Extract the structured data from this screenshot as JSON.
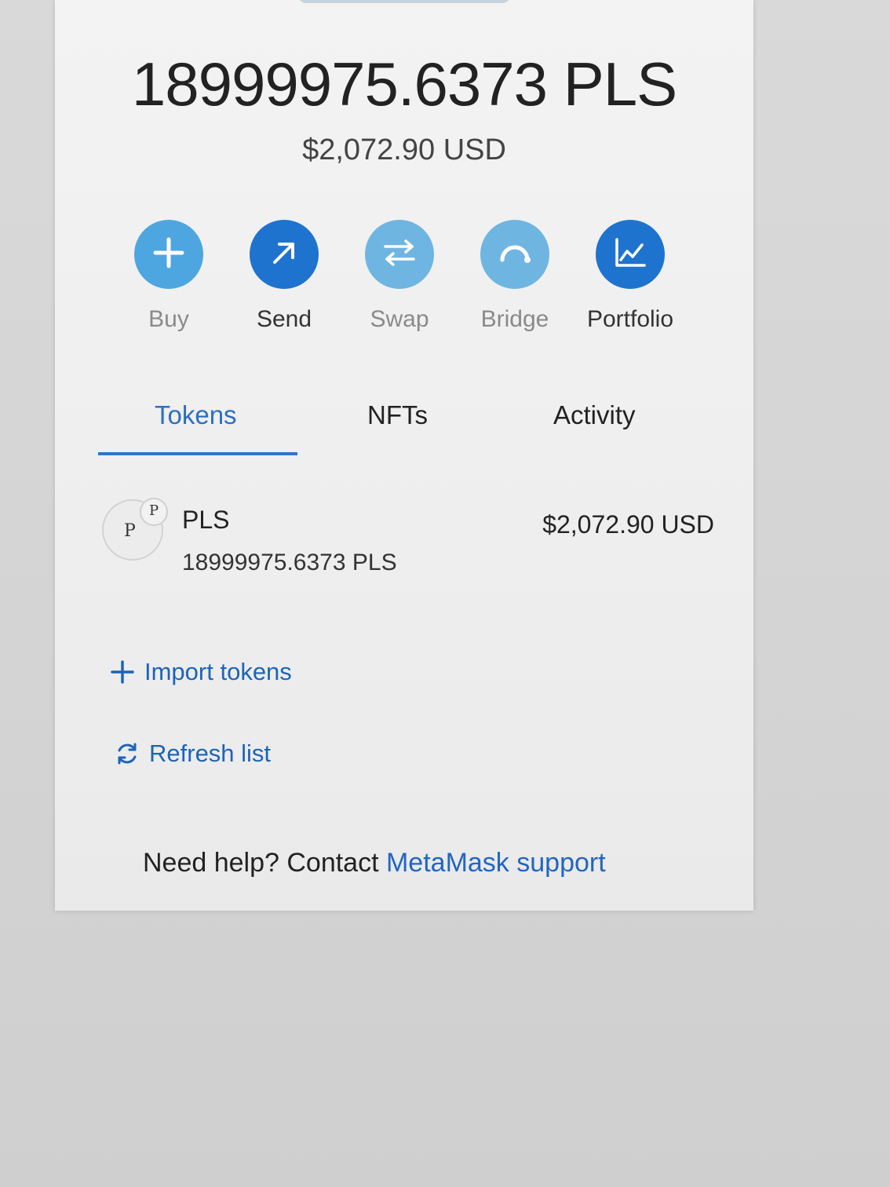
{
  "balance": {
    "amount": "18999975.6373 PLS",
    "fiat": "$2,072.90 USD"
  },
  "actions": [
    {
      "label": "Buy",
      "icon": "plus-icon",
      "color": "#4ea6e0"
    },
    {
      "label": "Send",
      "icon": "arrow-up-right-icon",
      "color": "#1e73cf"
    },
    {
      "label": "Swap",
      "icon": "swap-arrows-icon",
      "color": "#6fb5e2"
    },
    {
      "label": "Bridge",
      "icon": "bridge-icon",
      "color": "#6fb5e2"
    },
    {
      "label": "Portfolio",
      "icon": "chart-line-icon",
      "color": "#1e73cf"
    }
  ],
  "tabs": [
    {
      "label": "Tokens",
      "active": true
    },
    {
      "label": "NFTs",
      "active": false
    },
    {
      "label": "Activity",
      "active": false
    }
  ],
  "tokens": [
    {
      "icon_letter": "P",
      "badge_letter": "P",
      "name": "PLS",
      "amount": "18999975.6373 PLS",
      "value": "$2,072.90 USD"
    }
  ],
  "links": {
    "import_tokens": "Import tokens",
    "refresh_list": "Refresh list"
  },
  "help": {
    "prefix": "Need help? Contact ",
    "link": "MetaMask support"
  },
  "colors": {
    "accent": "#1e73cf",
    "link": "#1d64b8",
    "tab_active": "#2d74c9"
  }
}
